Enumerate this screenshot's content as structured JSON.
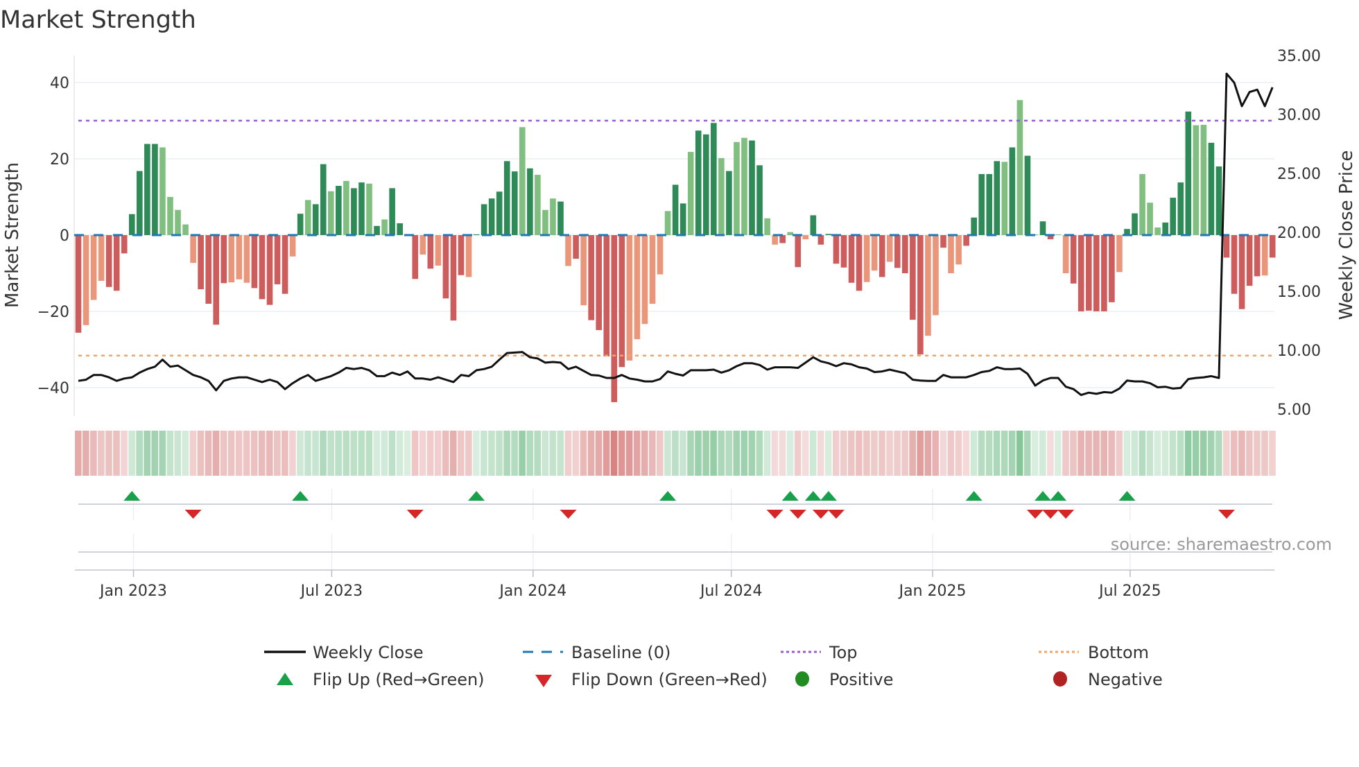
{
  "title": "Market Strength",
  "source": "source: sharemaestro.com",
  "legend": {
    "weekly_close": "Weekly Close",
    "baseline": "Baseline (0)",
    "top": "Top",
    "bottom": "Bottom",
    "flip_up": "Flip Up (Red→Green)",
    "flip_down": "Flip Down (Green→Red)",
    "positive": "Positive",
    "negative": "Negative"
  },
  "colors": {
    "pos_dark": "#2e8b57",
    "pos_light": "#80bf80",
    "neg_dark": "#cd5c5c",
    "neg_light": "#e9967a",
    "line": "#111111",
    "baseline": "#1f77b4",
    "top": "#9b59d6",
    "bottom": "#f4a460",
    "flip_up": "#18a04a",
    "flip_down": "#d62728",
    "positive": "#228b22",
    "negative": "#b22222"
  },
  "chart_data": {
    "type": "bar",
    "title": "Market Strength",
    "ylabel": "Market Strength",
    "y2label": "Weekly Close Price",
    "ylim": [
      -46,
      47
    ],
    "y2lim": [
      5,
      35
    ],
    "yticks": [
      40,
      20,
      0,
      -20,
      -40
    ],
    "yticklabels": [
      "40",
      "20",
      "0",
      "−20",
      "−40"
    ],
    "y2ticks": [
      35,
      30,
      25,
      20,
      15,
      10,
      5
    ],
    "y2ticklabels": [
      "35.00",
      "30.00",
      "25.00",
      "20.00",
      "15.00",
      "10.00",
      "5.00"
    ],
    "top_level": 30,
    "bottom_level": -31.6,
    "baseline": 0,
    "xticks": [
      {
        "label": "Jan 2023",
        "week": 8.2
      },
      {
        "label": "Jul 2023",
        "week": 34.1
      },
      {
        "label": "Jan 2024",
        "week": 60.4
      },
      {
        "label": "Jul 2024",
        "week": 86.3
      },
      {
        "label": "Jan 2025",
        "week": 112.6
      },
      {
        "label": "Jul 2025",
        "week": 138.4
      }
    ],
    "strength": [
      -25.6,
      -23.6,
      -17,
      -12,
      -13.6,
      -14.6,
      -4.8,
      5.5,
      16.8,
      23.9,
      23.9,
      23,
      10,
      6.6,
      2.8,
      -7.3,
      -14.2,
      -18,
      -23.5,
      -12.6,
      -12.4,
      -11.6,
      -12.5,
      -13.9,
      -16.8,
      -18.3,
      -12.9,
      -15.4,
      -5.6,
      5.6,
      9.2,
      8.1,
      18.6,
      11.5,
      12.9,
      14.2,
      12.3,
      13.8,
      13.5,
      2.4,
      4.1,
      12.3,
      3.1,
      0.2,
      -11.5,
      -5.1,
      -8.8,
      -8,
      -16.6,
      -22.4,
      -10.5,
      -11,
      0.2,
      8.1,
      9.6,
      11.4,
      19.4,
      16.7,
      28.3,
      17.5,
      15.8,
      6.6,
      9.6,
      8.8,
      -8.1,
      -6.2,
      -18.4,
      -22.3,
      -24.9,
      -31.8,
      -43.8,
      -34.6,
      -32.9,
      -27.3,
      -23.3,
      -18,
      -10.3,
      6.3,
      13.2,
      8.3,
      21.8,
      27.4,
      26.4,
      29.4,
      20.2,
      16.8,
      24.4,
      25.5,
      24.8,
      18.3,
      4.4,
      -2.5,
      -2.1,
      0.8,
      -8.4,
      -1.1,
      5.2,
      -2.5,
      0.3,
      -7.5,
      -8.5,
      -12.5,
      -14.6,
      -12.3,
      -9.3,
      -11,
      -7,
      -8.6,
      -10,
      -22.2,
      -31.3,
      -26.4,
      -21,
      -3.3,
      -10,
      -7.7,
      -2.8,
      4.6,
      16,
      16,
      19.4,
      19.2,
      23,
      35.4,
      20.8,
      0.1,
      3.6,
      -1.1,
      0.1,
      -10,
      -12.7,
      -20,
      -19.8,
      -20,
      -20,
      -17.6,
      -9.7,
      1.6,
      5.7,
      16,
      8.5,
      2,
      3.3,
      9.8,
      13.8,
      32.4,
      28.8,
      28.9,
      24.2,
      18,
      -5.9,
      -15.4,
      -19.4,
      -13.3,
      -10.8,
      -10.6,
      -5.9
    ],
    "shade": "dllldddddddlllllddddllldddddldlddldlddldlddddldldddlddddddldllldldldddddllllllddldddldllddlldldldddddddlldlddddlldlldddddldldddddlddddddlddlllddddlldddddddldllddddllll",
    "close": [
      7.4,
      7.5,
      7.9,
      7.9,
      7.7,
      7.4,
      7.6,
      7.7,
      8.1,
      8.4,
      8.6,
      9.2,
      8.6,
      8.7,
      8.3,
      7.9,
      7.7,
      7.4,
      6.6,
      7.4,
      7.6,
      7.7,
      7.7,
      7.5,
      7.3,
      7.5,
      7.3,
      6.7,
      7.2,
      7.6,
      7.9,
      7.4,
      7.6,
      7.8,
      8.1,
      8.5,
      8.4,
      8.5,
      8.3,
      7.8,
      7.8,
      8.1,
      7.9,
      8.2,
      7.6,
      7.6,
      7.5,
      7.7,
      7.5,
      7.3,
      7.9,
      7.8,
      8.3,
      8.4,
      8.6,
      9.2,
      9.76,
      9.8,
      9.85,
      9.4,
      9.3,
      8.95,
      9.0,
      8.95,
      8.4,
      8.6,
      8.25,
      7.9,
      7.85,
      7.65,
      7.65,
      7.9,
      7.6,
      7.5,
      7.35,
      7.35,
      7.55,
      8.2,
      8.0,
      7.85,
      8.3,
      8.3,
      8.3,
      8.35,
      8.1,
      8.3,
      8.65,
      8.9,
      8.9,
      8.75,
      8.35,
      8.55,
      8.55,
      8.55,
      8.5,
      8.95,
      9.4,
      9.05,
      8.9,
      8.65,
      8.9,
      8.8,
      8.55,
      8.45,
      8.15,
      8.2,
      8.35,
      8.2,
      8.05,
      7.5,
      7.43,
      7.4,
      7.4,
      7.9,
      7.7,
      7.7,
      7.7,
      7.9,
      8.15,
      8.25,
      8.55,
      8.4,
      8.4,
      8.45,
      8.0,
      7.0,
      7.43,
      7.65,
      7.65,
      6.9,
      6.7,
      6.2,
      6.4,
      6.3,
      6.45,
      6.4,
      6.75,
      7.43,
      7.35,
      7.35,
      7.2,
      6.85,
      6.9,
      6.75,
      6.8,
      7.55,
      7.65,
      7.7,
      7.8,
      7.65,
      33.46,
      32.7,
      30.7,
      31.9,
      32.1,
      30.7,
      32.3
    ],
    "flip_up_weeks": [
      8,
      30,
      53,
      78,
      94,
      97,
      99,
      118,
      127,
      129,
      138
    ],
    "flip_down_weeks": [
      16,
      45,
      65,
      92,
      95,
      98,
      100,
      126,
      128,
      130,
      151
    ],
    "legend_position": "bottom"
  }
}
